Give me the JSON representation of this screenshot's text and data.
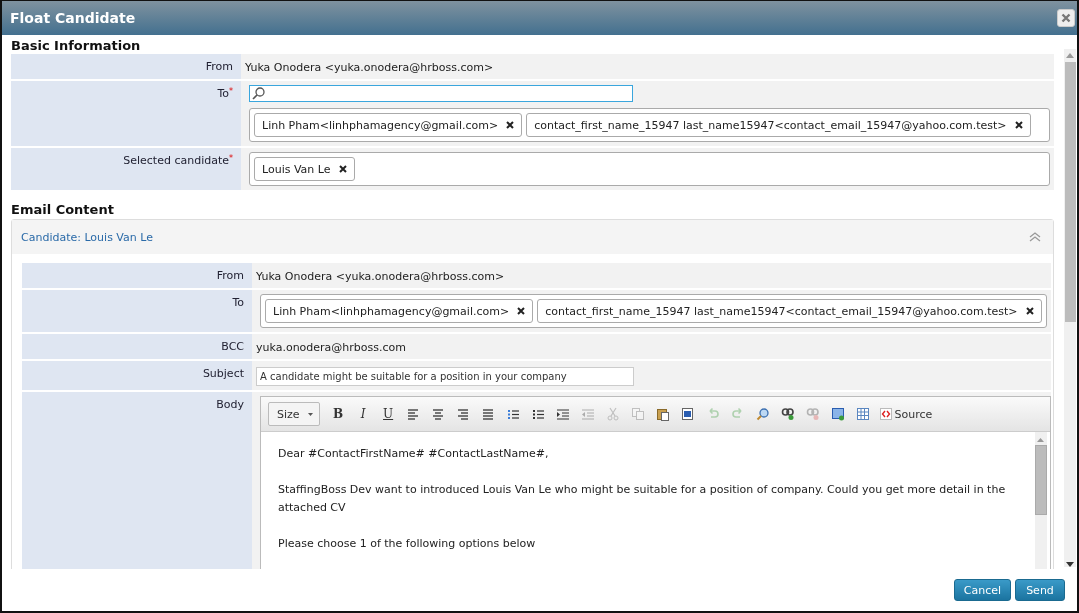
{
  "window": {
    "title": "Float Candidate"
  },
  "required_mark": "*",
  "basic": {
    "heading": "Basic Information",
    "from_label": "From",
    "from": "Yuka Onodera <yuka.onodera@hrboss.com>",
    "to_label": "To",
    "to_required": true,
    "to_recipients": [
      "Linh Pham<linhphamagency@gmail.com>",
      "contact_first_name_15947 last_name15947<contact_email_15947@yahoo.com.test>"
    ],
    "candidate_label": "Selected candidate",
    "candidate_required": true,
    "candidates": [
      "Louis Van Le"
    ]
  },
  "email": {
    "heading": "Email Content",
    "panel_title": "Candidate: Louis Van Le",
    "expanded": true,
    "from_label": "From",
    "from": "Yuka Onodera <yuka.onodera@hrboss.com>",
    "to_label": "To",
    "to_recipients": [
      "Linh Pham<linhphamagency@gmail.com>",
      "contact_first_name_15947 last_name15947<contact_email_15947@yahoo.com.test>"
    ],
    "bcc_label": "BCC",
    "bcc": "yuka.onodera@hrboss.com",
    "subject_label": "Subject",
    "subject": "A candidate might be suitable for a position in your company",
    "body_label": "Body",
    "toolbar": [
      {
        "kind": "size",
        "label": "Size",
        "disabled": false
      },
      {
        "kind": "bold",
        "label": "B",
        "disabled": false
      },
      {
        "kind": "italic",
        "label": "I",
        "disabled": false
      },
      {
        "kind": "underline",
        "label": "U",
        "disabled": false
      },
      {
        "kind": "align-left",
        "disabled": false
      },
      {
        "kind": "align-center",
        "disabled": false
      },
      {
        "kind": "align-right",
        "disabled": false
      },
      {
        "kind": "justify",
        "disabled": false
      },
      {
        "kind": "bullets",
        "disabled": false
      },
      {
        "kind": "numbers",
        "disabled": false
      },
      {
        "kind": "indent",
        "disabled": false
      },
      {
        "kind": "outdent",
        "disabled": true
      },
      {
        "kind": "cut",
        "disabled": true
      },
      {
        "kind": "copy",
        "disabled": true
      },
      {
        "kind": "paste",
        "disabled": false
      },
      {
        "kind": "paste-word",
        "disabled": false
      },
      {
        "kind": "undo",
        "disabled": true
      },
      {
        "kind": "redo",
        "disabled": true
      },
      {
        "kind": "find",
        "disabled": false
      },
      {
        "kind": "link",
        "disabled": false
      },
      {
        "kind": "unlink",
        "disabled": true
      },
      {
        "kind": "image",
        "disabled": false
      },
      {
        "kind": "table",
        "disabled": false
      },
      {
        "kind": "source",
        "label": "Source",
        "disabled": false
      }
    ],
    "body": [
      "Dear #ContactFirstName# #ContactLastName#,",
      "StaffingBoss Dev want to introduced Louis Van Le who might be suitable for a position of company. Could you get more detail in the attached CV",
      "Please choose 1 of the following options below"
    ]
  },
  "buttons": [
    {
      "label": "Cancel"
    },
    {
      "label": "Send"
    }
  ]
}
